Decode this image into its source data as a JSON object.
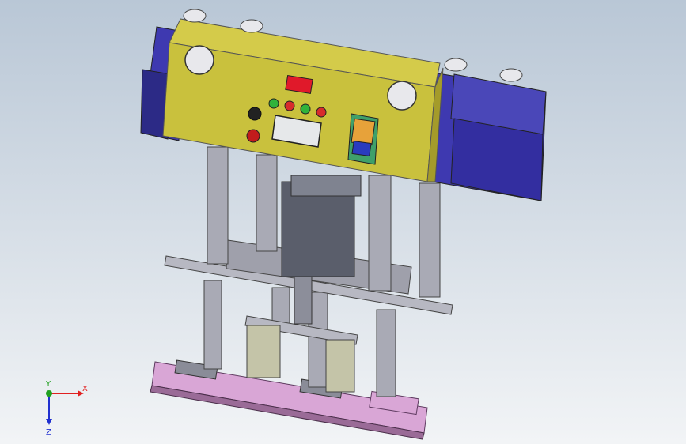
{
  "viewport": {
    "background_top": "#b9c7d6",
    "background_bottom": "#f2f4f6"
  },
  "model": {
    "colors": {
      "housing_yellow": "#c9c13d",
      "housing_yellow_dark": "#a49b2a",
      "side_blue": "#3e39b0",
      "side_blue_dark": "#2c2a86",
      "column_grey": "#a9aab5",
      "plate_grey": "#b7b8c2",
      "base_pink": "#d9a6d6",
      "cylinder_dark": "#5a5e6b",
      "display_red": "#e0192a",
      "lamp_green": "#2fb33b",
      "lamp_red": "#d82c2c",
      "controller_orange": "#e7a23a"
    },
    "icons": [
      "lamp-indicator",
      "push-button",
      "hmi-screen",
      "digital-display",
      "controller-panel"
    ]
  },
  "triad": {
    "x_label": "X",
    "y_label": "Y",
    "z_label": "Z",
    "x_color": "#e02020",
    "y_color": "#20a020",
    "z_color": "#2030d0"
  }
}
